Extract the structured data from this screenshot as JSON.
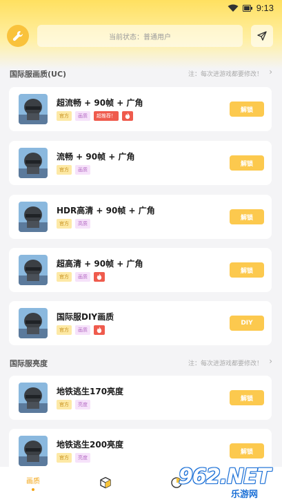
{
  "status_bar": {
    "time": "9:13"
  },
  "header": {
    "status_text": "当前状态：普通用户"
  },
  "sections": [
    {
      "title": "国际服画质(UC)",
      "note": "注：每次进游戏都要修改！"
    },
    {
      "title": "国际服亮度",
      "note": "注：每次进游戏都要修改！"
    }
  ],
  "cards": [
    {
      "title": "超流畅 + 90帧 + 广角",
      "tag_official": "官方",
      "tag_quality": "画质",
      "tag_hot": "超推荐！",
      "action": "解锁"
    },
    {
      "title": "流畅 + 90帧 + 广角",
      "tag_official": "官方",
      "tag_quality": "画质",
      "action": "解锁"
    },
    {
      "title": "HDR高清 + 90帧 + 广角",
      "tag_official": "官方",
      "tag_quality": "高质",
      "action": "解锁"
    },
    {
      "title": "超高清 + 90帧 + 广角",
      "tag_official": "官方",
      "tag_quality": "画质",
      "action": "解锁"
    },
    {
      "title": "国际服DIY画质",
      "tag_official": "官方",
      "tag_quality": "画质",
      "action": "DIY"
    },
    {
      "title": "地铁逃生170亮度",
      "tag_official": "官方",
      "tag_quality": "亮度",
      "action": "解锁"
    },
    {
      "title": "地铁逃生200亮度",
      "tag_official": "官方",
      "tag_quality": "亮度",
      "action": "解锁"
    }
  ],
  "bottom_nav": {
    "active_label": "画质"
  },
  "watermark": {
    "logo": "962.NET",
    "sub": "乐游网"
  },
  "colors": {
    "accent": "#fcc94e",
    "tab_active": "#f2a516",
    "hot": "#ef5b4d"
  },
  "icons": [
    "wifi-icon",
    "battery-icon",
    "wrench-icon",
    "send-icon",
    "flame-icon",
    "cube-icon",
    "pie-icon"
  ]
}
